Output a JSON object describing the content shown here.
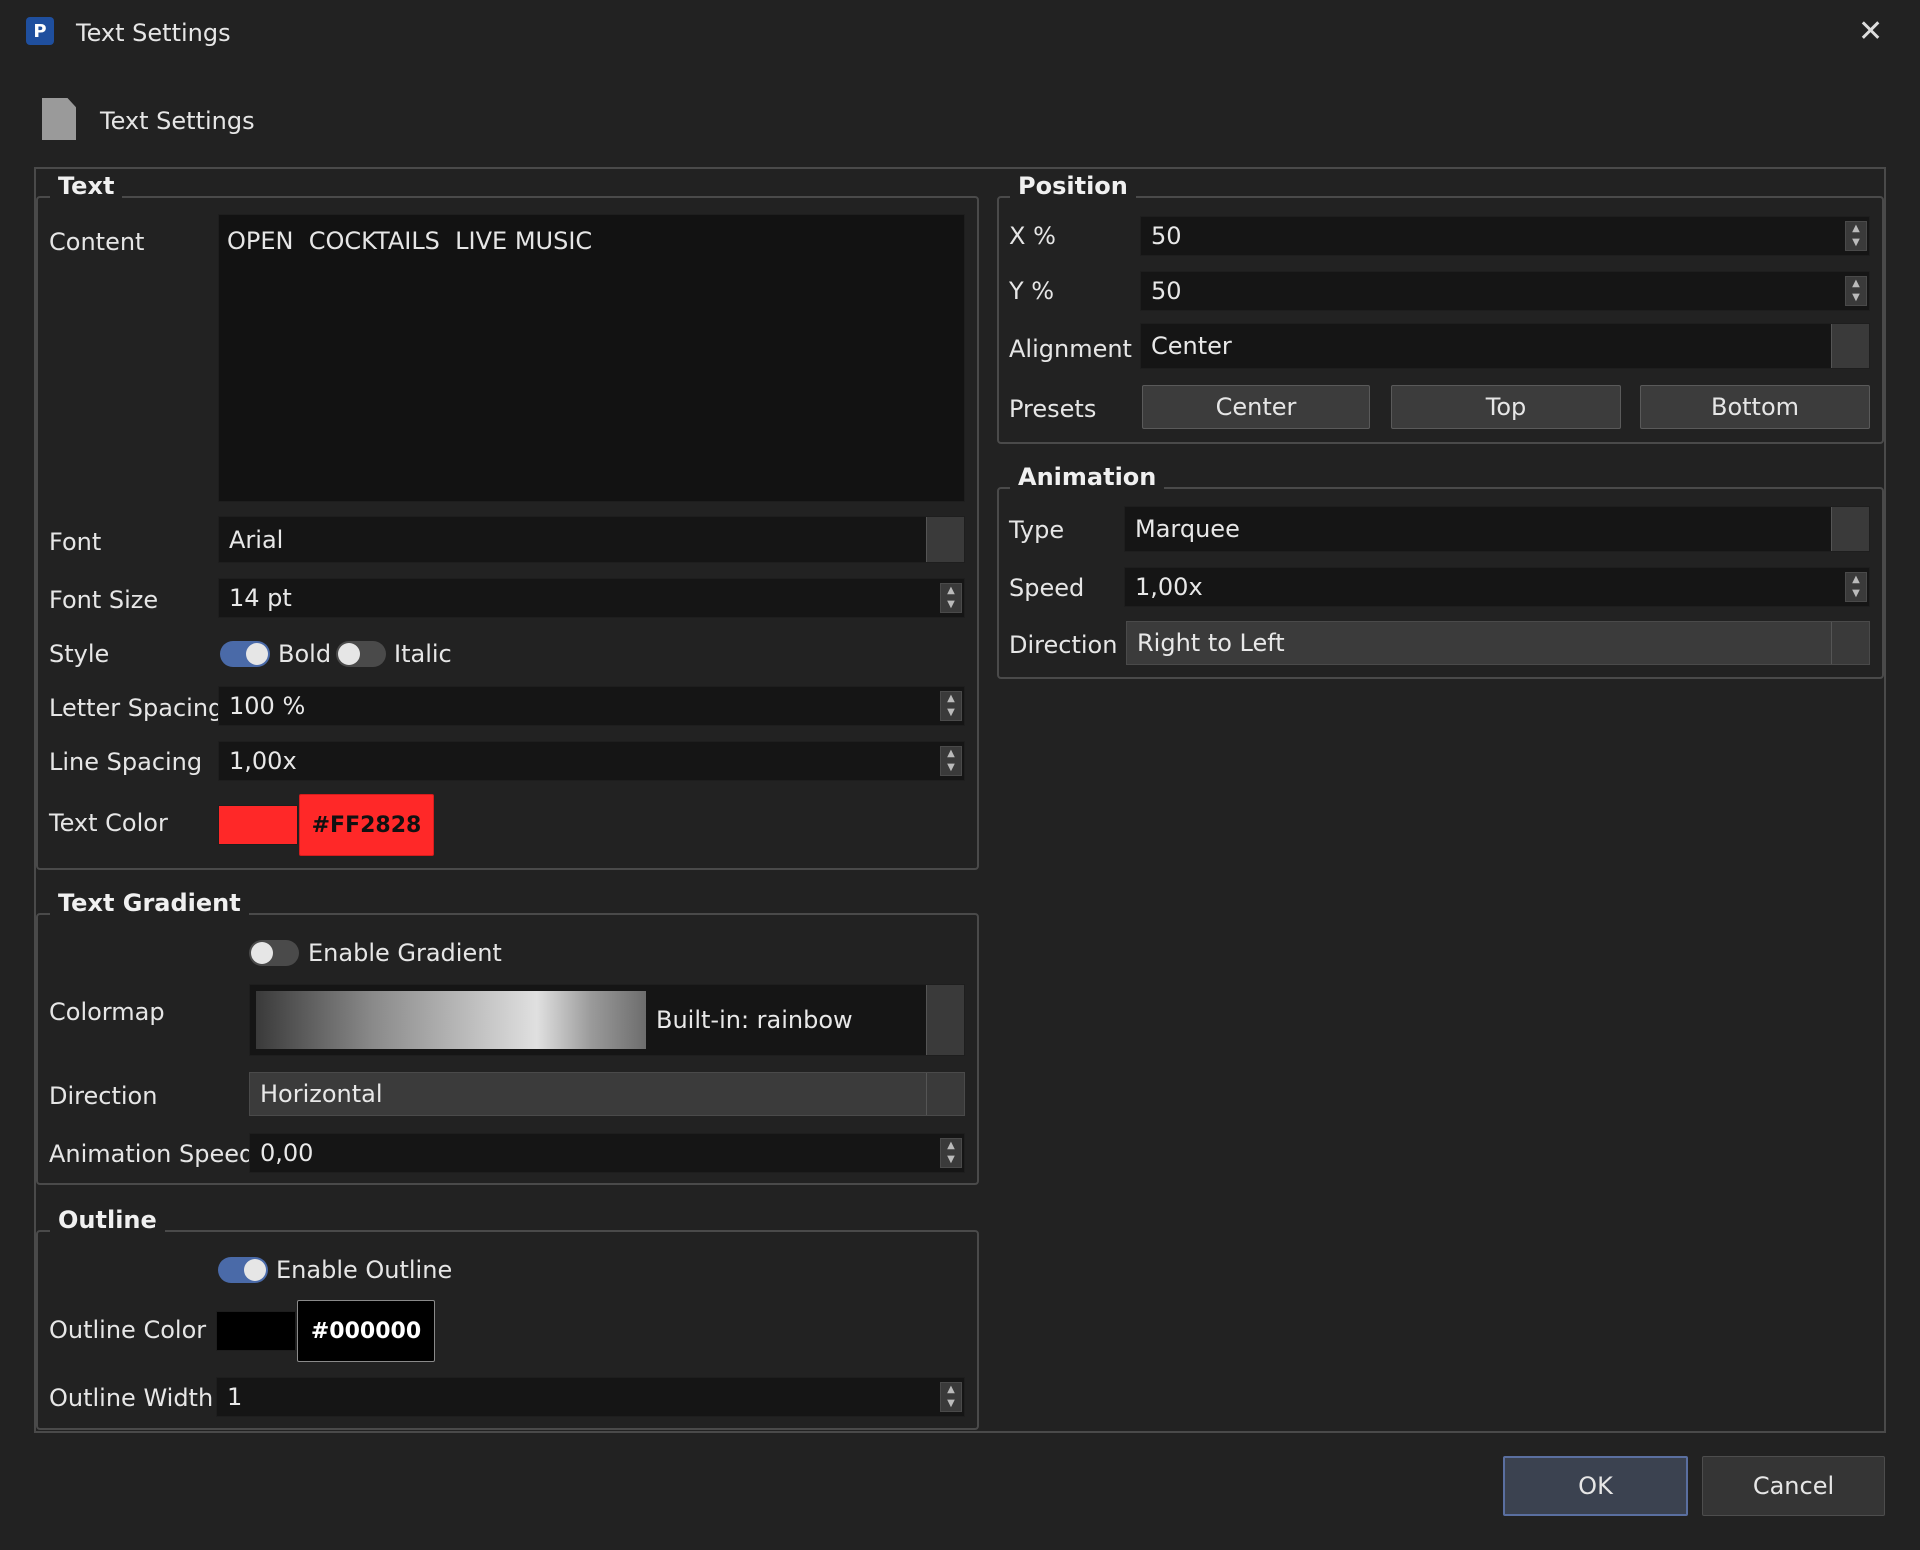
{
  "window": {
    "title": "Text Settings",
    "close_glyph": "✕"
  },
  "header": {
    "title": "Text Settings"
  },
  "text_group": {
    "title": "Text",
    "content_label": "Content",
    "content_value": "OPEN  COCKTAILS  LIVE MUSIC",
    "font_label": "Font",
    "font_value": "Arial",
    "font_size_label": "Font Size",
    "font_size_value": "14 pt",
    "style_label": "Style",
    "bold_label": "Bold",
    "bold_on": true,
    "italic_label": "Italic",
    "italic_on": false,
    "letter_spacing_label": "Letter Spacing",
    "letter_spacing_value": "100 %",
    "line_spacing_label": "Line Spacing",
    "line_spacing_value": "1,00x",
    "text_color_label": "Text Color",
    "text_color_hex": "#FF2828"
  },
  "gradient_group": {
    "title": "Text Gradient",
    "enable_label": "Enable Gradient",
    "enable_on": false,
    "colormap_label": "Colormap",
    "colormap_value": "Built-in: rainbow",
    "direction_label": "Direction",
    "direction_value": "Horizontal",
    "animation_speed_label": "Animation Speed",
    "animation_speed_value": "0,00"
  },
  "outline_group": {
    "title": "Outline",
    "enable_label": "Enable Outline",
    "enable_on": true,
    "color_label": "Outline Color",
    "color_hex": "#000000",
    "width_label": "Outline Width",
    "width_value": "1"
  },
  "position_group": {
    "title": "Position",
    "x_label": "X %",
    "x_value": "50",
    "y_label": "Y %",
    "y_value": "50",
    "alignment_label": "Alignment",
    "alignment_value": "Center",
    "presets_label": "Presets",
    "preset_center": "Center",
    "preset_top": "Top",
    "preset_bottom": "Bottom"
  },
  "animation_group": {
    "title": "Animation",
    "type_label": "Type",
    "type_value": "Marquee",
    "speed_label": "Speed",
    "speed_value": "1,00x",
    "direction_label": "Direction",
    "direction_value": "Right to Left"
  },
  "footer": {
    "ok_label": "OK",
    "cancel_label": "Cancel"
  },
  "colors": {
    "background": "#222222",
    "accent": "#4a6aa8",
    "text_color": "#FF2828",
    "outline_color": "#000000"
  }
}
